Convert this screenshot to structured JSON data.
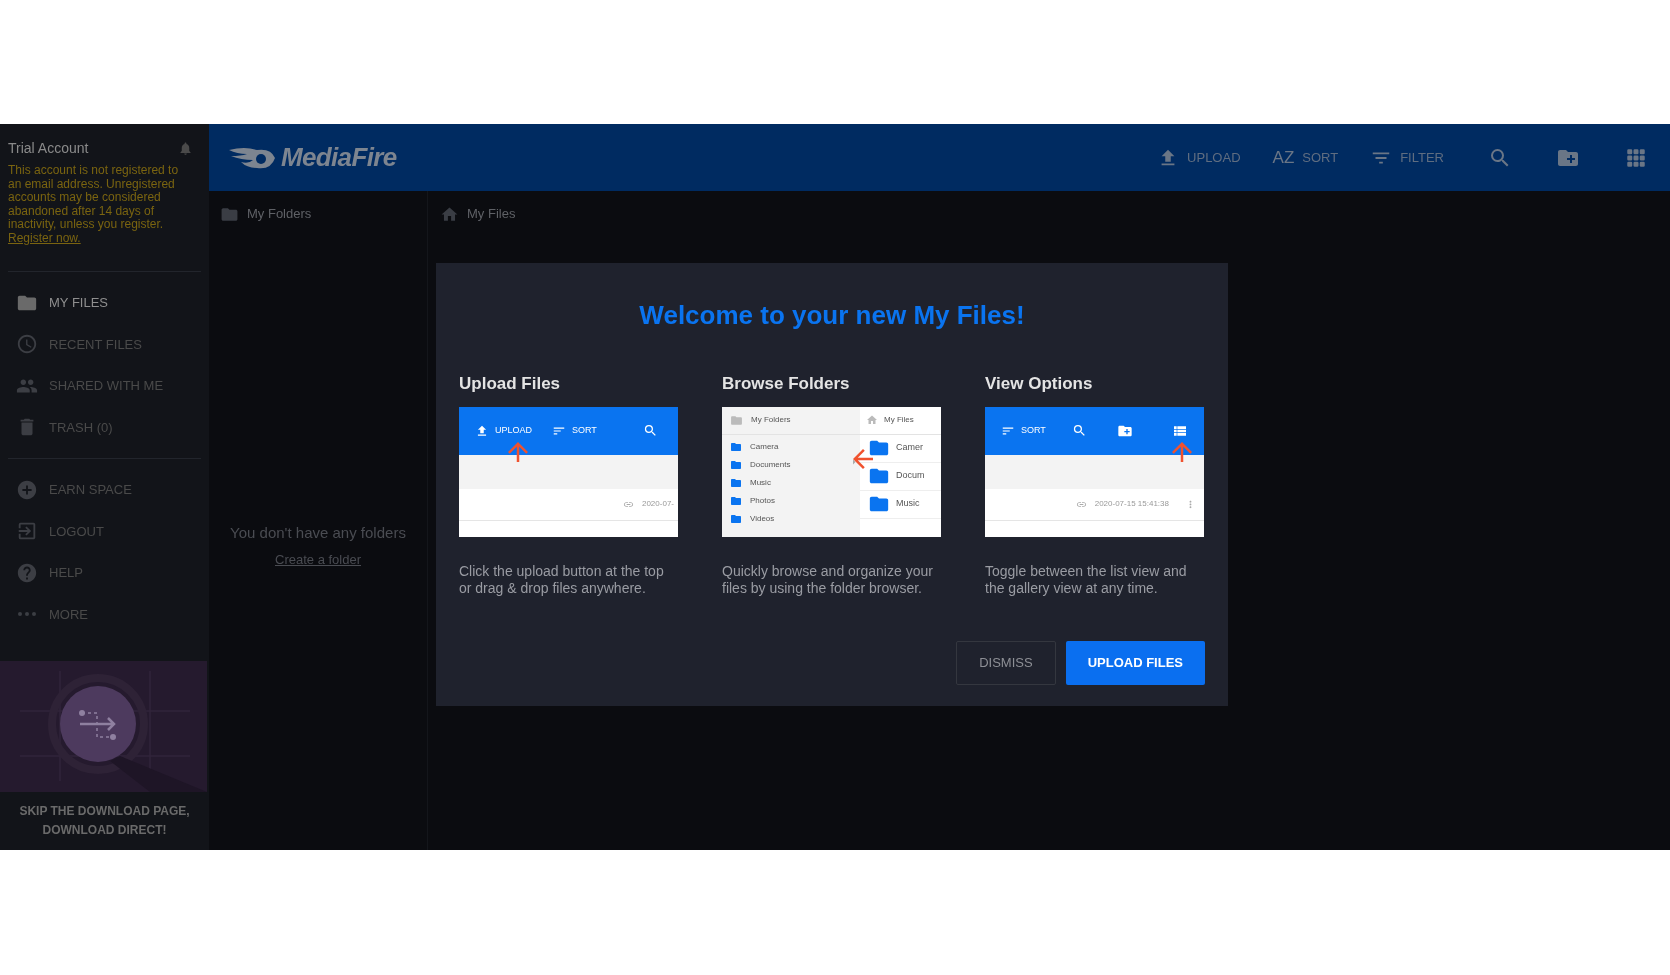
{
  "sidebar": {
    "account_title": "Trial Account",
    "notice": "This account is not registered to an email address. Unregistered accounts may be considered abandoned after 14 days of inactivity, unless you register.",
    "notice_link": "Register now.",
    "nav_groups": [
      [
        {
          "label": "MY FILES",
          "selected": true
        },
        {
          "label": "RECENT FILES",
          "selected": false
        },
        {
          "label": "SHARED WITH ME",
          "selected": false
        },
        {
          "label": "TRASH (0)",
          "selected": false
        }
      ],
      [
        {
          "label": "EARN SPACE",
          "selected": false
        },
        {
          "label": "LOGOUT",
          "selected": false
        },
        {
          "label": "HELP",
          "selected": false
        },
        {
          "label": "MORE",
          "selected": false
        }
      ]
    ],
    "promo_caption": "SKIP THE DOWNLOAD PAGE, DOWNLOAD DIRECT!"
  },
  "header": {
    "logo": "MediaFire",
    "actions": [
      {
        "label": "UPLOAD"
      },
      {
        "label": "SORT",
        "icon_text": "AZ"
      },
      {
        "label": "FILTER"
      }
    ]
  },
  "folder_panel": {
    "title": "My Folders",
    "empty_text": "You don't have any folders",
    "create_link": "Create a folder"
  },
  "breadcrumb": "My Files",
  "modal": {
    "title": "Welcome to your new My Files!",
    "sections": [
      {
        "title": "Upload Files",
        "description": "Click the upload button at the top or drag & drop files anywhere.",
        "preview": {
          "kind": "upload",
          "toolbar": [
            "UPLOAD",
            "SORT"
          ],
          "rows": [
            "2020-07-"
          ]
        }
      },
      {
        "title": "Browse Folders",
        "description": "Quickly browse and organize your files by using the folder browser.",
        "preview": {
          "kind": "folders",
          "left_title": "My Folders",
          "folders": [
            "Camera",
            "Documents",
            "Music",
            "Photos",
            "Videos"
          ],
          "right_title": "My Files",
          "files": [
            "Camer",
            "Docum",
            "Music"
          ]
        }
      },
      {
        "title": "View Options",
        "description": "Toggle between the list view and the gallery view at any time.",
        "preview": {
          "kind": "view",
          "toolbar": [
            "SORT"
          ],
          "rows": [
            "2020-07-15 15:41:38"
          ]
        }
      }
    ],
    "buttons": [
      {
        "label": "DISMISS",
        "primary": false
      },
      {
        "label": "UPLOAD FILES",
        "primary": true
      }
    ]
  }
}
